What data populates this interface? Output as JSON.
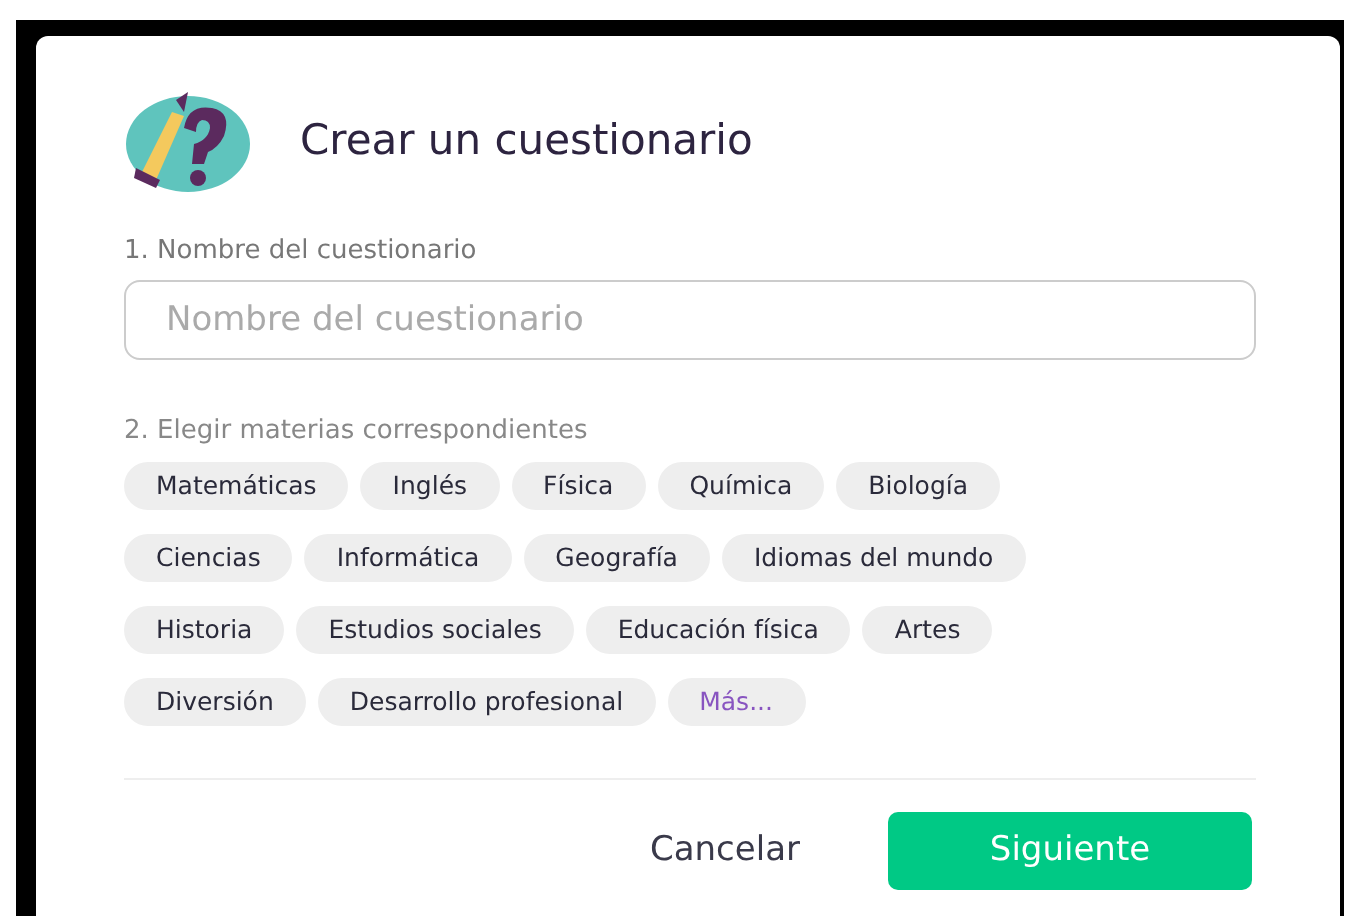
{
  "dialog": {
    "title": "Crear un cuestionario"
  },
  "name_field": {
    "label": "1. Nombre del cuestionario",
    "placeholder": "Nombre del cuestionario"
  },
  "subjects": {
    "label": "2. Elegir materias correspondientes",
    "chips": [
      {
        "label": "Matemáticas",
        "kind": "subject"
      },
      {
        "label": "Inglés",
        "kind": "subject"
      },
      {
        "label": "Física",
        "kind": "subject"
      },
      {
        "label": "Química",
        "kind": "subject"
      },
      {
        "label": "Biología",
        "kind": "subject"
      },
      {
        "label": "Ciencias",
        "kind": "subject"
      },
      {
        "label": "Informática",
        "kind": "subject"
      },
      {
        "label": "Geografía",
        "kind": "subject"
      },
      {
        "label": "Idiomas del mundo",
        "kind": "subject"
      },
      {
        "label": "Historia",
        "kind": "subject"
      },
      {
        "label": "Estudios sociales",
        "kind": "subject"
      },
      {
        "label": "Educación física",
        "kind": "subject"
      },
      {
        "label": "Artes",
        "kind": "subject"
      },
      {
        "label": "Diversión",
        "kind": "subject"
      },
      {
        "label": "Desarrollo profesional",
        "kind": "subject"
      },
      {
        "label": "Más...",
        "kind": "more"
      }
    ]
  },
  "buttons": {
    "cancel": "Cancelar",
    "next": "Siguiente"
  }
}
